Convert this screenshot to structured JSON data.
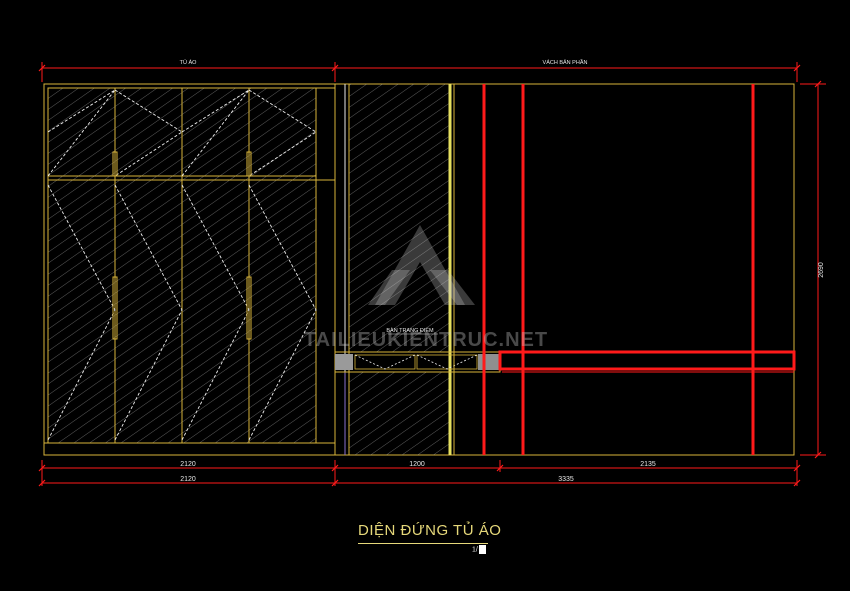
{
  "labels": {
    "wardrobe": "TỦ ÁO",
    "partition": "VÁCH BẢN PHẦN",
    "dresser": "BÀN TRANG ĐIỂM",
    "height": "2690",
    "watermark_text": "TAILIEUKIENTRUC.NET"
  },
  "dimensions": {
    "row1": [
      "2120",
      "1200",
      "2135"
    ],
    "row2": [
      "2120",
      "3335"
    ]
  },
  "title": {
    "text": "DIỆN ĐỨNG TỦ ÁO",
    "scale_prefix": "1/"
  },
  "colors": {
    "outline": "#d8b43a",
    "dimension": "#ff1a1a",
    "background": "#000000",
    "title": "#e6d87a"
  }
}
